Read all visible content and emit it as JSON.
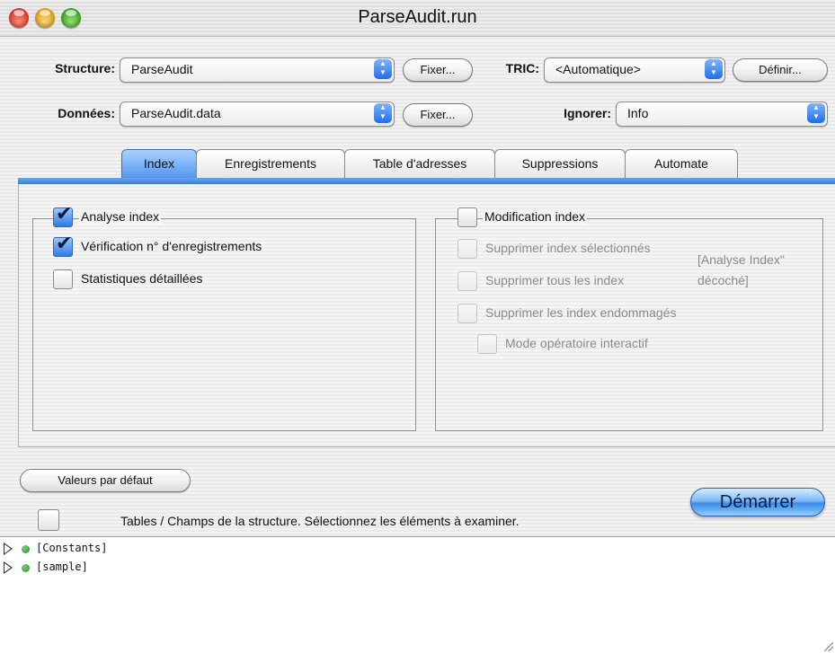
{
  "window": {
    "title": "ParseAudit.run"
  },
  "top": {
    "structure_label": "Structure:",
    "structure_value": "ParseAudit",
    "structure_fix": "Fixer...",
    "tric_label": "TRIC:",
    "tric_value": "<Automatique>",
    "tric_define": "Définir...",
    "data_label": "Données:",
    "data_value": "ParseAudit.data",
    "data_fix": "Fixer...",
    "ignore_label": "Ignorer:",
    "ignore_value": "Info"
  },
  "tabs": [
    {
      "label": "Index",
      "active": true
    },
    {
      "label": "Enregistrements",
      "active": false
    },
    {
      "label": "Table d'adresses",
      "active": false
    },
    {
      "label": "Suppressions",
      "active": false
    },
    {
      "label": "Automate",
      "active": false
    }
  ],
  "index_pane": {
    "left": {
      "analyse": {
        "label": "Analyse index",
        "checked": true
      },
      "verification": {
        "label": "Vérification n° d'enregistrements",
        "checked": true
      },
      "statistiques": {
        "label": "Statistiques détaillées",
        "checked": false
      }
    },
    "right": {
      "modification": {
        "label": "Modification index",
        "checked": false
      },
      "supprimer_selection": {
        "label": "Supprimer index sélectionnés",
        "checked": false
      },
      "supprimer_tous": {
        "label": "Supprimer tous les index",
        "checked": false
      },
      "supprimer_endommages": {
        "label": "Supprimer les index endommagés",
        "checked": false
      },
      "mode_interactif": {
        "label": "Mode opératoire interactif",
        "checked": false
      },
      "note_line1": "[Analyse Index\"",
      "note_line2": "décoché]"
    }
  },
  "bottom": {
    "defaults_button": "Valeurs par défaut",
    "start_button": "Démarrer",
    "tables_hint": "Tables / Champs de la structure. Sélectionnez les éléments à examiner.",
    "tables_checked": false
  },
  "tree": [
    {
      "label": "[Constants]"
    },
    {
      "label": "[sample]"
    }
  ],
  "colors": {
    "accent": "#3e7ad3",
    "status_dot": "#2a8a2a"
  }
}
